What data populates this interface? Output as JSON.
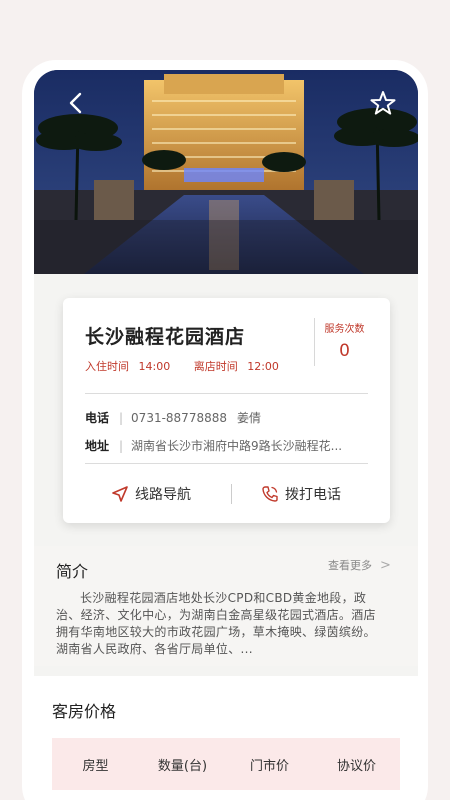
{
  "nav": {
    "back_icon": "back-arrow-icon",
    "favorite_icon": "star-outline-icon"
  },
  "hotel": {
    "name": "长沙融程花园酒店",
    "checkin_label": "入住时间",
    "checkin_time": "14:00",
    "checkout_label": "离店时间",
    "checkout_time": "12:00",
    "service_label": "服务次数",
    "service_count": "0",
    "phone_label": "电话",
    "phone": "0731-88778888",
    "contact": "姜倩",
    "address_label": "地址",
    "address": "湖南省长沙市湘府中路9路长沙融程花..."
  },
  "actions": {
    "navigate_label": "线路导航",
    "navigate_icon": "navigation-arrow-icon",
    "call_label": "拨打电话",
    "call_icon": "phone-icon"
  },
  "intro": {
    "title": "简介",
    "more_label": "查看更多",
    "more_arrow": ">",
    "text": "长沙融程花园酒店地处长沙CPD和CBD黄金地段，政治、经济、文化中心，为湖南白金高星级花园式酒店。酒店拥有华南地区较大的市政花园广场，草木掩映、绿茵缤纷。湖南省人民政府、各省厅局单位、..."
  },
  "rooms": {
    "title": "客房价格",
    "columns": [
      "房型",
      "数量(台)",
      "门市价",
      "协议价"
    ]
  },
  "colors": {
    "accent": "#c0392b",
    "table_header_bg": "#fbe9e9"
  }
}
